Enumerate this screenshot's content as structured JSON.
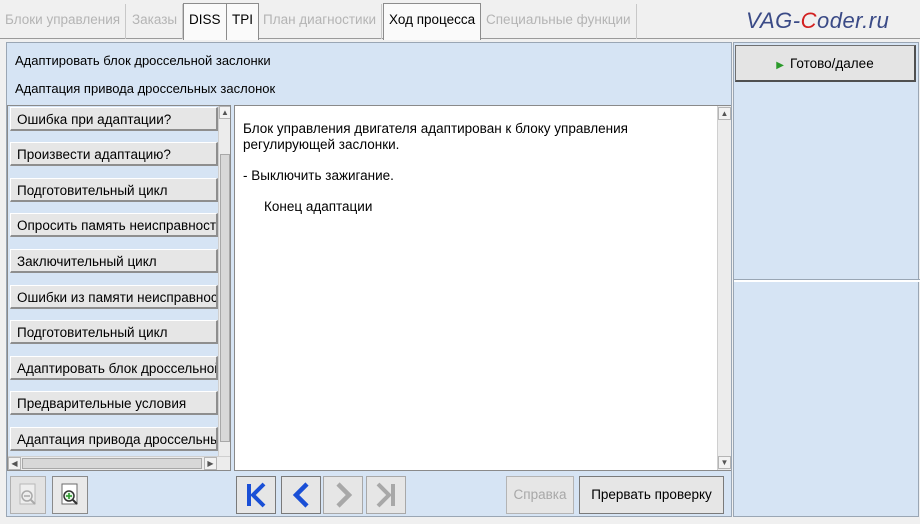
{
  "tabs": [
    {
      "label": "Блоки управления",
      "state": "disabled"
    },
    {
      "label": "Заказы",
      "state": "disabled"
    },
    {
      "label": "DISS",
      "state": "enabled"
    },
    {
      "label": "TPI",
      "state": "enabled"
    },
    {
      "label": "План диагностики",
      "state": "disabled"
    },
    {
      "label": "Ход процесса",
      "state": "active"
    },
    {
      "label": "Специальные функции",
      "state": "disabled"
    }
  ],
  "watermark": {
    "part1": "VAG-",
    "part2": "C",
    "part3": "oder.ru"
  },
  "header": {
    "line1": "Адаптировать блок дроссельной заслонки",
    "line2": "Адаптация привода дроссельных заслонок"
  },
  "steps": [
    "Ошибка при адаптации?",
    "Произвести адаптацию?",
    "Подготовительный цикл",
    "Опросить память неисправностей",
    "Заключительный цикл",
    "Ошибки из памяти неисправностей",
    "Подготовительный цикл",
    "Адаптировать блок дроссельной заслонки",
    "Предварительные условия",
    "Адаптация привода дроссельных заслонок"
  ],
  "content": {
    "line1": "Блок управления двигателя адаптирован к блоку управления",
    "line2": "регулирующей заслонки.",
    "line3": "- Выключить зажигание.",
    "line4": "Конец адаптации"
  },
  "right_panel": {
    "go_label": "Готово/далее"
  },
  "bottom": {
    "help_label": "Справка",
    "abort_label": "Прервать проверку"
  },
  "colors": {
    "panel_bg": "#d6e4f4",
    "nav_blue": "#1a4fd6",
    "go_green": "#2a9a2a"
  }
}
